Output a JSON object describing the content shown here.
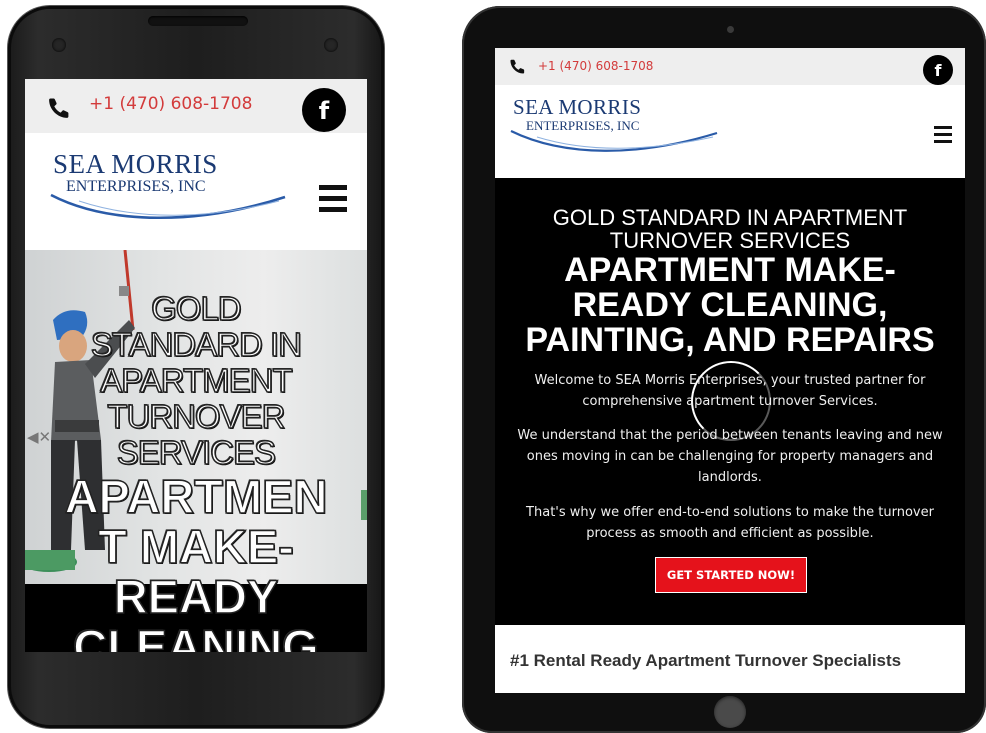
{
  "site": {
    "phone_number": "+1 (470) 608-1708",
    "facebook_label": "f",
    "logo_line1": "SEA MORRIS",
    "logo_line2": "ENTERPRISES, INC",
    "brand_color": "#1b3a73",
    "accent_color": "#d33b3b"
  },
  "hero": {
    "subtitle": "GOLD STANDARD IN APARTMENT TURNOVER SERVICES",
    "title": "APARTMENT MAKE-READY CLEANING, PAINTING, AND REPAIRS",
    "paragraph1": "Welcome to SEA Morris Enterprises, your trusted partner for comprehensive apartment turnover Services.",
    "paragraph2": "We understand that the period between tenants leaving and new ones moving in can be challenging for property managers and landlords.",
    "paragraph3": "That's why we offer end-to-end solutions to make the turnover process as smooth and efficient as possible.",
    "cta_label": "GET STARTED NOW!",
    "cta_color": "#e5121b"
  },
  "mobile": {
    "hero_sub_lines": [
      "GOLD",
      "STANDARD IN",
      "APARTMENT",
      "TURNOVER",
      "SERVICES"
    ],
    "hero_main_lines": [
      "APARTMEN",
      "T MAKE-",
      "READY",
      "CLEANING"
    ],
    "mute_label": "◀✕"
  },
  "section": {
    "title": "#1 Rental Ready Apartment Turnover Specialists"
  },
  "icons": {
    "phone": "phone-icon",
    "facebook": "facebook-icon",
    "menu": "hamburger-menu-icon"
  }
}
